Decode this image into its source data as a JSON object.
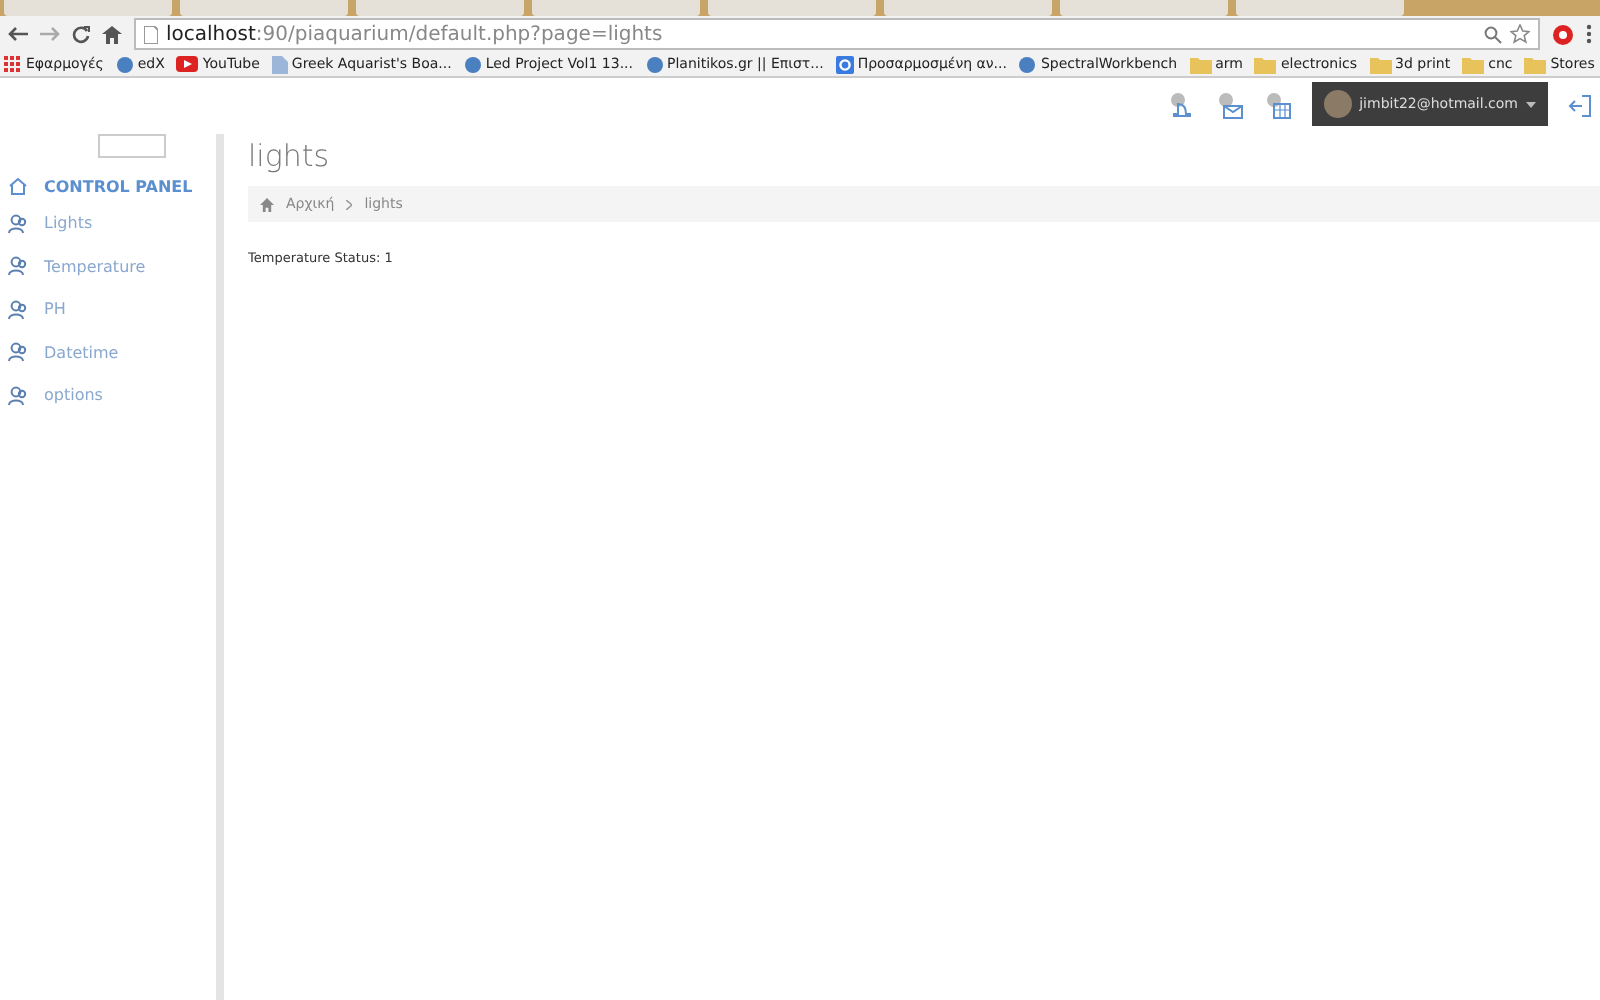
{
  "browser": {
    "url_host": "localhost",
    "url_path": ":90/piaquarium/default.php?page=lights",
    "bookmarks": [
      {
        "label": "Εφαρμογές",
        "kind": "apps"
      },
      {
        "label": "edX",
        "kind": "site"
      },
      {
        "label": "YouTube",
        "kind": "video"
      },
      {
        "label": "Greek Aquarist's Boa...",
        "kind": "page"
      },
      {
        "label": "Led Project Vol1 13...",
        "kind": "site"
      },
      {
        "label": "Planitikos.gr || Επιστ...",
        "kind": "site"
      },
      {
        "label": "Προσαρμοσμένη αν...",
        "kind": "google"
      },
      {
        "label": "SpectralWorkbench",
        "kind": "site"
      },
      {
        "label": "arm",
        "kind": "folder"
      },
      {
        "label": "electronics",
        "kind": "folder"
      },
      {
        "label": "3d print",
        "kind": "folder"
      },
      {
        "label": "cnc",
        "kind": "folder"
      },
      {
        "label": "Stores",
        "kind": "folder"
      }
    ]
  },
  "header": {
    "user": "jimbit22@hotmail.com"
  },
  "sidebar": {
    "title": "CONTROL PANEL",
    "items": [
      {
        "label": "Lights"
      },
      {
        "label": "Temperature"
      },
      {
        "label": "PH"
      },
      {
        "label": "Datetime"
      },
      {
        "label": "options"
      }
    ]
  },
  "page": {
    "title": "lights",
    "breadcrumb": [
      "Αρχική",
      "lights"
    ],
    "status": "Temperature Status: 1"
  }
}
